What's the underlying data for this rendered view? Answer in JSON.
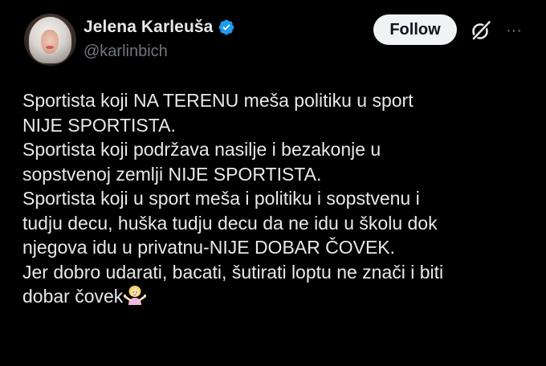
{
  "author": {
    "display_name": "Jelena Karleuša",
    "handle": "@karlinbich",
    "verified": true
  },
  "actions": {
    "follow_label": "Follow",
    "grok_icon": "grok-icon",
    "more_icon": "more-icon",
    "more_glyph": "···"
  },
  "tweet": {
    "lines": [
      "Sportista koji NA TERENU meša politiku u sport",
      "NIJE SPORTISTA.",
      "Sportista koji podržava nasilje i bezakonje u",
      "sopstvenoj zemlji NIJE SPORTISTA.",
      "Sportista koji u sport meša i politiku i sopstvenu i",
      "tudju decu, huška tudju decu da ne idu u školu dok",
      "njegova idu u privatnu-NIJE DOBAR ČOVEK.",
      "Jer dobro udarati, bacati, šutirati loptu ne znači i biti",
      "dobar čovek"
    ],
    "trailing_emoji": "shrugging-woman-emoji"
  },
  "colors": {
    "background": "#000000",
    "text": "#e7e9ea",
    "secondary": "#71767b",
    "verified": "#1d9bf0",
    "follow_bg": "#eff3f4"
  }
}
